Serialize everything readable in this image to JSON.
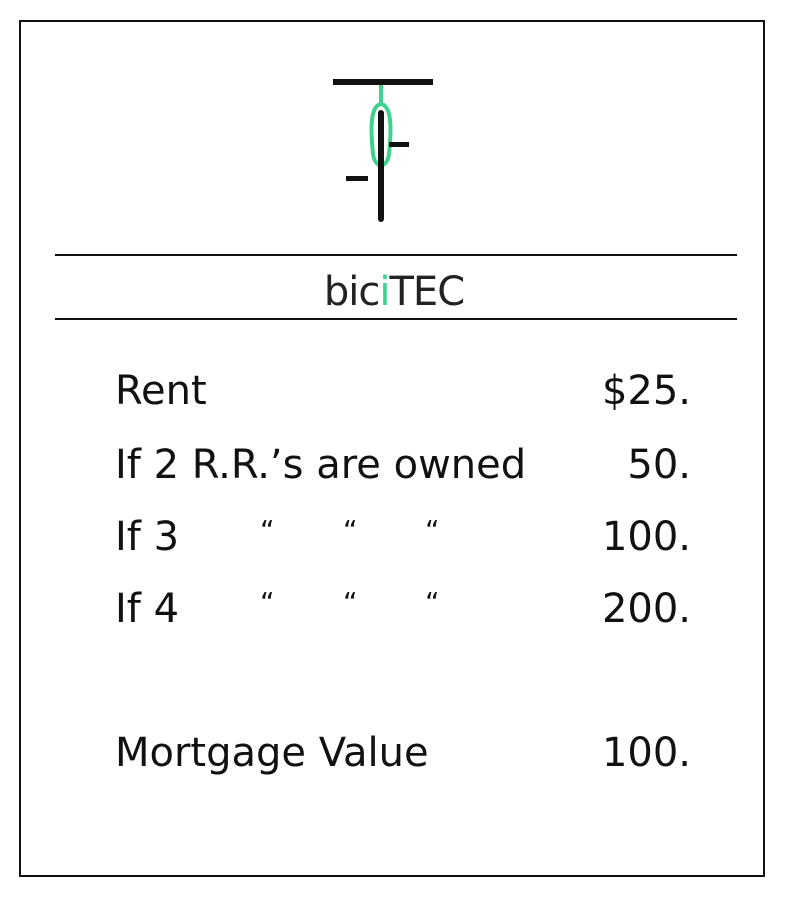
{
  "brand": {
    "name_prefix": "bic",
    "name_green_i": "i",
    "name_suffix": "TEC",
    "accent_color": "#3fd18f"
  },
  "rent_table": {
    "rows": [
      {
        "label": "Rent",
        "value": "$25."
      },
      {
        "label": "If 2 R.R.’s are owned",
        "value": "50."
      },
      {
        "label": "If 3",
        "ditto": [
          "“",
          "“",
          "“"
        ],
        "value": "100."
      },
      {
        "label": "If 4",
        "ditto": [
          "“",
          "“",
          "“"
        ],
        "value": "200."
      }
    ],
    "mortgage": {
      "label": "Mortgage Value",
      "value": "100."
    }
  },
  "icons": {
    "logo": "bicycle-front-view-icon"
  }
}
